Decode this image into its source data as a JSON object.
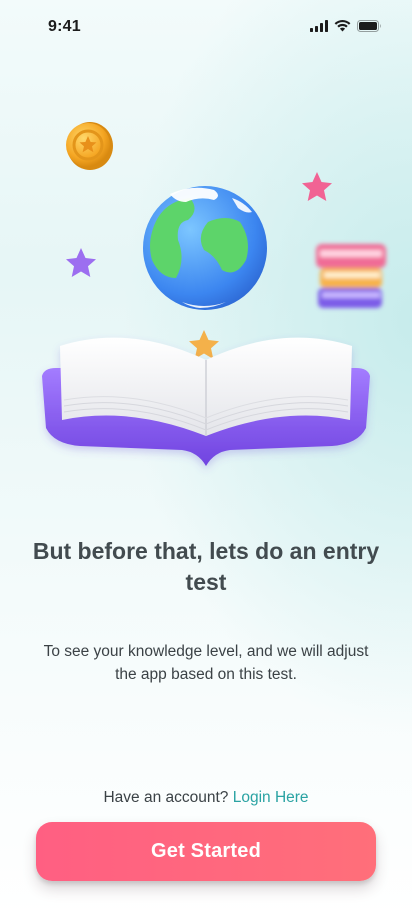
{
  "status_bar": {
    "time": "9:41"
  },
  "onboarding": {
    "headline": "But before that, lets do an entry test",
    "subtext": "To see your knowledge level, and we will adjust the app based on this test."
  },
  "account": {
    "prompt": "Have an account?",
    "login_label": "Login Here"
  },
  "cta": {
    "label": "Get Started"
  },
  "colors": {
    "accent": "#ff6078",
    "link": "#2aa3a3",
    "heading": "#424b4f",
    "book_cover": "#8a5cf0"
  }
}
